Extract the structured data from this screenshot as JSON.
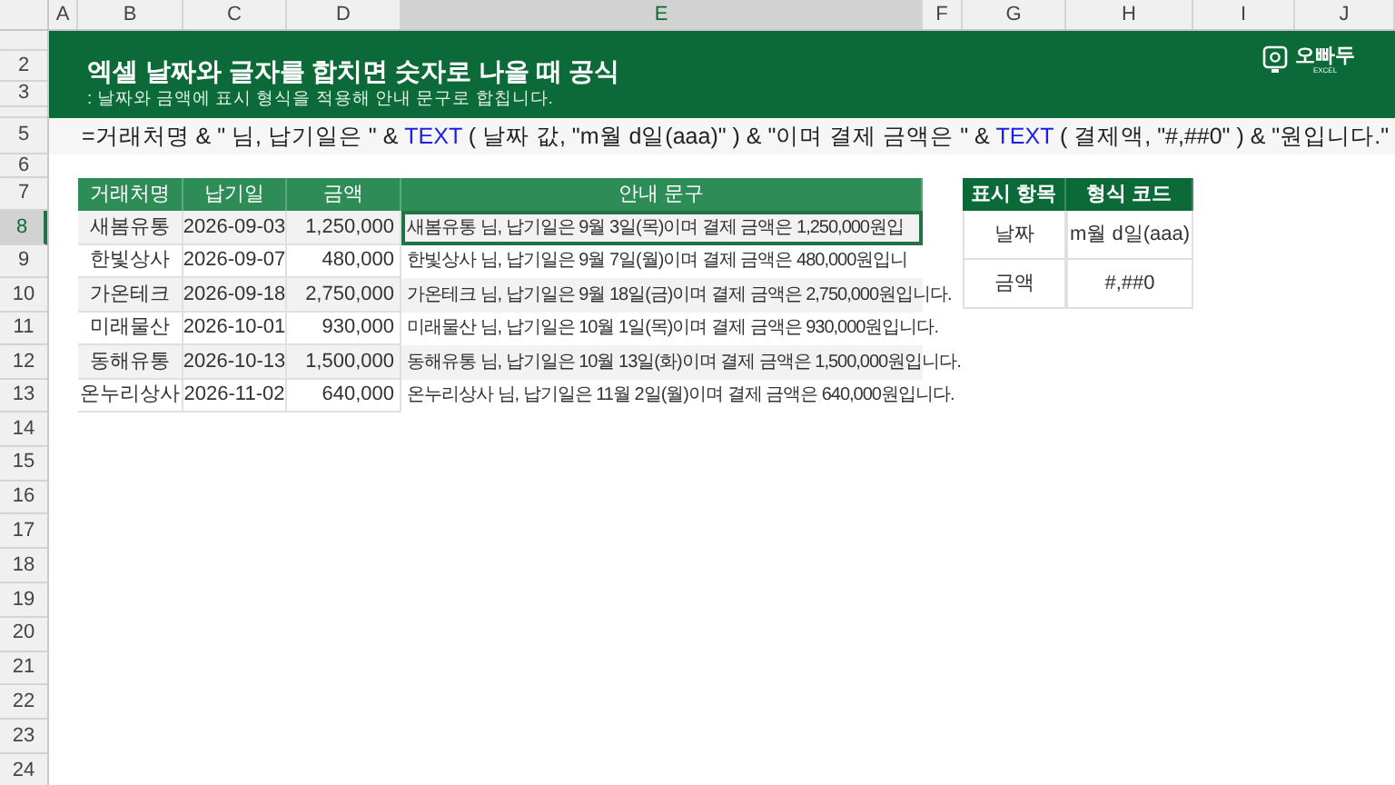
{
  "columns": [
    {
      "label": "A",
      "selected": false
    },
    {
      "label": "B",
      "selected": false
    },
    {
      "label": "C",
      "selected": false
    },
    {
      "label": "D",
      "selected": false
    },
    {
      "label": "E",
      "selected": true
    },
    {
      "label": "F",
      "selected": false
    },
    {
      "label": "G",
      "selected": false
    },
    {
      "label": "H",
      "selected": false
    },
    {
      "label": "I",
      "selected": false
    },
    {
      "label": "J",
      "selected": false
    }
  ],
  "row_numbers": [
    {
      "label": "2",
      "selected": false
    },
    {
      "label": "3",
      "selected": false
    },
    {
      "label": "5",
      "selected": false
    },
    {
      "label": "6",
      "selected": false
    },
    {
      "label": "7",
      "selected": false
    },
    {
      "label": "8",
      "selected": true
    },
    {
      "label": "9",
      "selected": false
    },
    {
      "label": "10",
      "selected": false
    },
    {
      "label": "11",
      "selected": false
    },
    {
      "label": "12",
      "selected": false
    },
    {
      "label": "13",
      "selected": false
    },
    {
      "label": "14",
      "selected": false
    },
    {
      "label": "15",
      "selected": false
    },
    {
      "label": "16",
      "selected": false
    },
    {
      "label": "17",
      "selected": false
    },
    {
      "label": "18",
      "selected": false
    },
    {
      "label": "19",
      "selected": false
    },
    {
      "label": "20",
      "selected": false
    },
    {
      "label": "21",
      "selected": false
    },
    {
      "label": "22",
      "selected": false
    },
    {
      "label": "23",
      "selected": false
    },
    {
      "label": "24",
      "selected": false
    }
  ],
  "banner": {
    "title": "엑셀 날짜와 글자를 합치면 숫자로 나올 때 공식",
    "subtitle": ": 날짜와 금액에 표시 형식을 적용해 안내 문구로 합칩니다.",
    "logo": {
      "name": "오빠두",
      "tag": "EXCEL"
    }
  },
  "formula": [
    {
      "kind": "text",
      "text": "=거래처명 & \" 님, 납기일은 \" & "
    },
    {
      "kind": "function",
      "text": "TEXT"
    },
    {
      "kind": "text",
      "text": " ( 날짜 값, \"m월 d일(aaa)\" ) & \"이며 결제 금액은 \" & "
    },
    {
      "kind": "function",
      "text": "TEXT"
    },
    {
      "kind": "text",
      "text": " ( 결제액, \"#,##0\" ) & \"원입니다.\""
    }
  ],
  "table": {
    "columns": [
      "거래처명",
      "납기일",
      "금액",
      "안내 문구"
    ],
    "rows": [
      {
        "cells": [
          "새봄유통",
          "2026-09-03",
          "1,250,000",
          "새봄유통 님, 납기일은 9월 3일(목)이며 결제 금액은 1,250,000원입"
        ],
        "selected": true
      },
      {
        "cells": [
          "한빛상사",
          "2026-09-07",
          "480,000",
          "한빛상사 님, 납기일은 9월 7일(월)이며 결제 금액은 480,000원입니"
        ],
        "selected": false
      },
      {
        "cells": [
          "가온테크",
          "2026-09-18",
          "2,750,000",
          "가온테크 님, 납기일은 9월 18일(금)이며 결제 금액은 2,750,000원입니다."
        ],
        "selected": false
      },
      {
        "cells": [
          "미래물산",
          "2026-10-01",
          "930,000",
          "미래물산 님, 납기일은 10월 1일(목)이며 결제 금액은 930,000원입니다."
        ],
        "selected": false
      },
      {
        "cells": [
          "동해유통",
          "2026-10-13",
          "1,500,000",
          "동해유통 님, 납기일은 10월 13일(화)이며 결제 금액은 1,500,000원입니다."
        ],
        "selected": false
      },
      {
        "cells": [
          "온누리상사",
          "2026-11-02",
          "640,000",
          "온누리상사 님, 납기일은 11월 2일(월)이며 결제 금액은 640,000원입니다."
        ],
        "selected": false
      }
    ]
  },
  "format_table": {
    "columns": [
      "표시 항목",
      "형식 코드"
    ],
    "rows": [
      [
        "날짜",
        "m월 d일(aaa)"
      ],
      [
        "금액",
        "#,##0"
      ]
    ]
  }
}
